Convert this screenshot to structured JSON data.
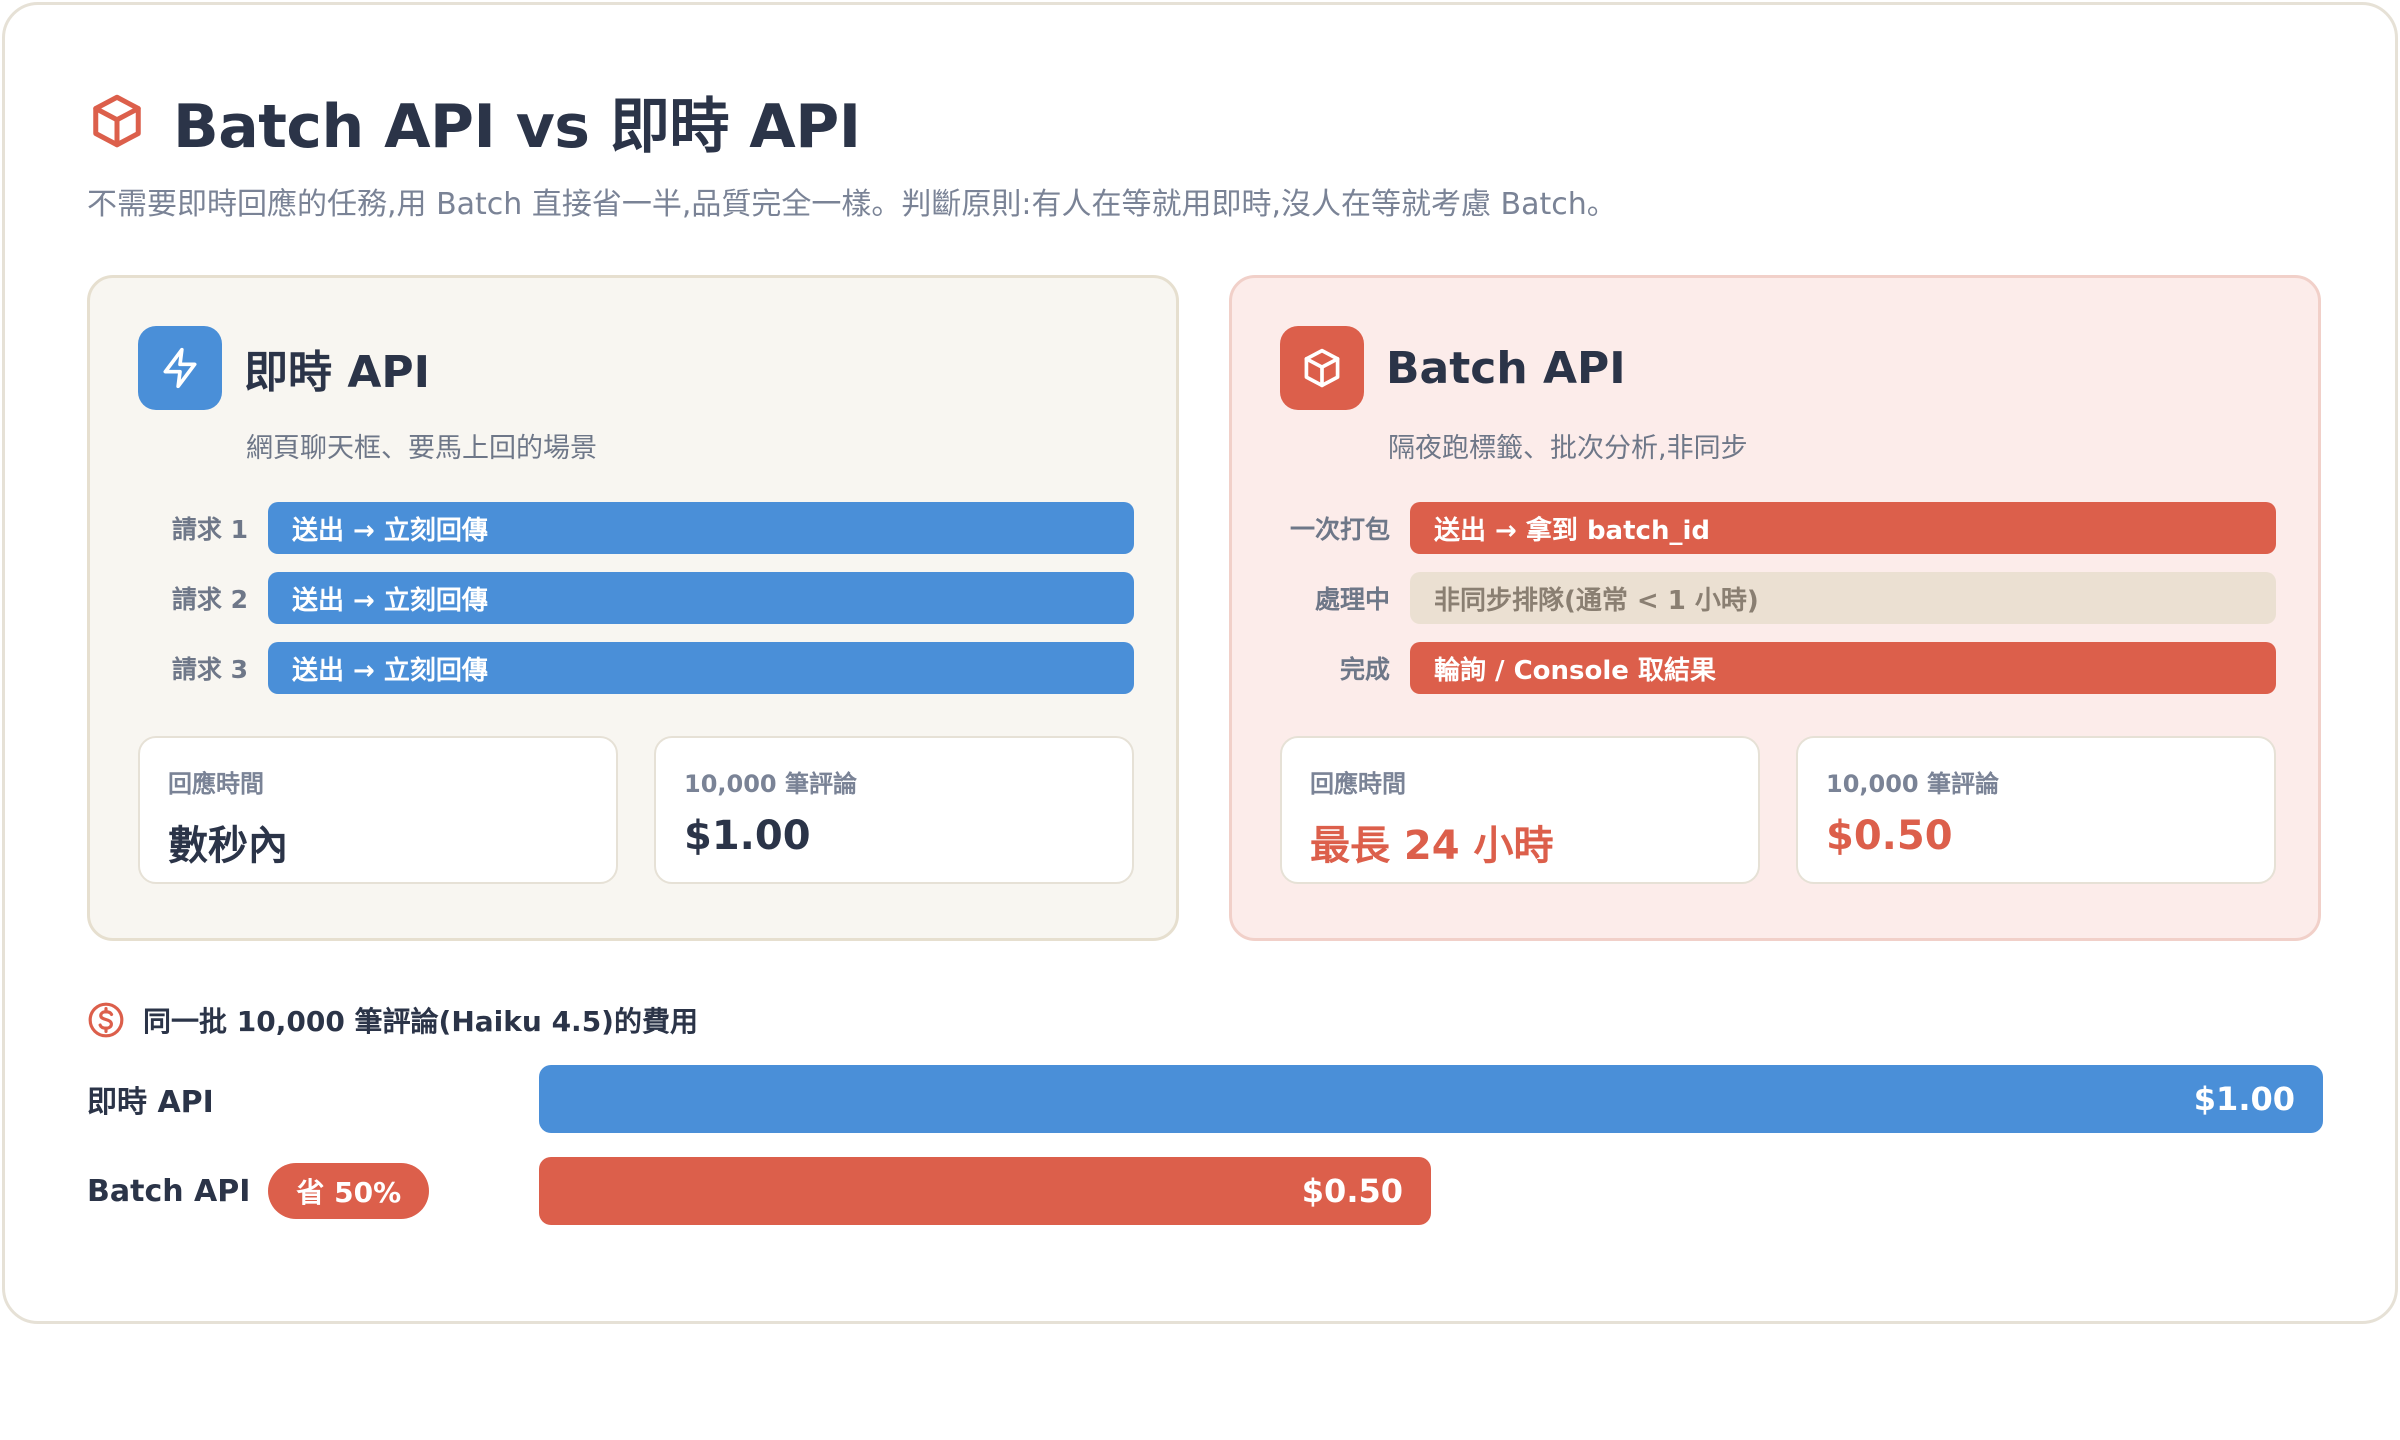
{
  "header": {
    "title": "Batch API vs 即時 API",
    "subtitle": "不需要即時回應的任務,用 Batch 直接省一半,品質完全一樣。判斷原則:有人在等就用即時,沒人在等就考慮 Batch。",
    "icon": "box-icon"
  },
  "colors": {
    "blue": "#4a8fd8",
    "red": "#dc5f4b",
    "tan": "#ebe0d2",
    "text": "#2b3448",
    "muted": "#7a8396"
  },
  "panels": {
    "realtime": {
      "title": "即時 API",
      "subtitle": "網頁聊天框、要馬上回的場景",
      "icon": "lightning-icon",
      "steps": [
        {
          "label": "請求 1",
          "text": "送出 → 立刻回傳"
        },
        {
          "label": "請求 2",
          "text": "送出 → 立刻回傳"
        },
        {
          "label": "請求 3",
          "text": "送出 → 立刻回傳"
        }
      ],
      "stats": [
        {
          "label": "回應時間",
          "value": "數秒內"
        },
        {
          "label": "10,000 筆評論",
          "value": "$1.00"
        }
      ]
    },
    "batch": {
      "title": "Batch API",
      "subtitle": "隔夜跑標籤、批次分析,非同步",
      "icon": "box-icon",
      "steps": [
        {
          "label": "一次打包",
          "text": "送出 → 拿到 batch_id"
        },
        {
          "label": "處理中",
          "text": "非同步排隊(通常 < 1 小時)"
        },
        {
          "label": "完成",
          "text": "輪詢 / Console 取結果"
        }
      ],
      "stats": [
        {
          "label": "回應時間",
          "value": "最長 24 小時"
        },
        {
          "label": "10,000 筆評論",
          "value": "$0.50"
        }
      ]
    }
  },
  "comparison": {
    "title": "同一批 10,000 筆評論(Haiku 4.5)的費用",
    "icon": "dollar-icon",
    "rows": [
      {
        "label": "即時 API",
        "value_label": "$1.00",
        "fraction": 1.0
      },
      {
        "label": "Batch API",
        "badge": "省 50%",
        "value_label": "$0.50",
        "fraction": 0.5
      }
    ]
  }
}
